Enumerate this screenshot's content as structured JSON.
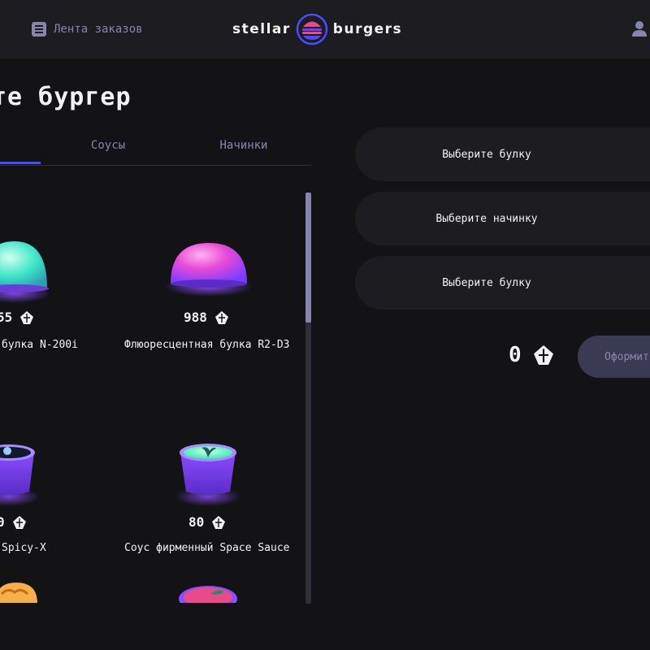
{
  "header": {
    "feed_label": "Лента заказов",
    "logo_left": "stellar",
    "logo_right": "burgers",
    "feed_icon": "list-icon",
    "profile_icon": "profile-icon"
  },
  "constructor": {
    "title": "те бургер",
    "tabs": [
      "Соусы",
      "Начинки"
    ]
  },
  "ingredients": [
    {
      "price": "55",
      "name": "булка N-200i",
      "image": "bun-teal"
    },
    {
      "price": "988",
      "name": "Флюоресцентная булка R2-D3",
      "image": "bun-pink"
    },
    {
      "price": "0",
      "name": "Spicy-X",
      "image": "sauce-spicy"
    },
    {
      "price": "80",
      "name": "Соус фирменный Space Sauce",
      "image": "sauce-space"
    }
  ],
  "burger": {
    "top_bun": "Выберите булку",
    "filling": "Выберите начинку",
    "bottom_bun": "Выберите булку",
    "total": "0",
    "order_button": "Оформит"
  },
  "colors": {
    "background": "#131316",
    "panel": "#1c1c21",
    "accent": "#4c4cff",
    "muted_text": "#8585ad"
  }
}
